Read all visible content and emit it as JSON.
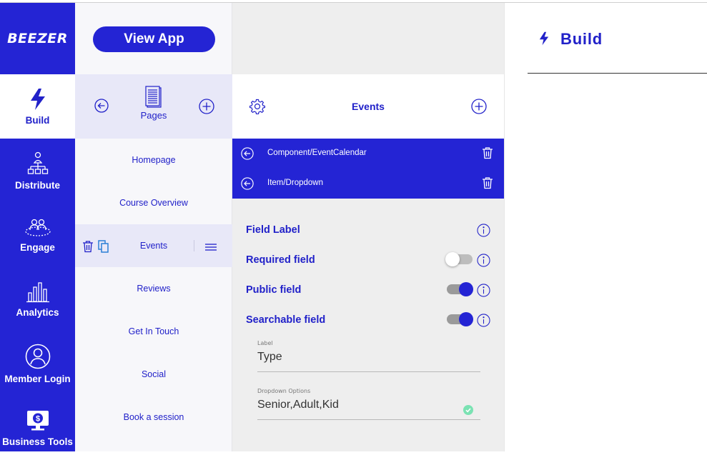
{
  "brand": {
    "logo_text": "BEEZER"
  },
  "nav": {
    "items": [
      {
        "label": "Build",
        "icon": "bolt-icon",
        "active": true
      },
      {
        "label": "Distribute",
        "icon": "org-chart-icon",
        "active": false
      },
      {
        "label": "Engage",
        "icon": "people-icon",
        "active": false
      },
      {
        "label": "Analytics",
        "icon": "bar-chart-icon",
        "active": false
      },
      {
        "label": "Member Login",
        "icon": "user-circle-icon",
        "active": false
      },
      {
        "label": "Business Tools",
        "icon": "dollar-monitor-icon",
        "active": false
      }
    ]
  },
  "pages": {
    "view_app_label": "View App",
    "header_label": "Pages",
    "list": [
      "Homepage",
      "Course Overview",
      "Events",
      "Reviews",
      "Get In Touch",
      "Social",
      "Book a session"
    ],
    "selected": "Events"
  },
  "editor": {
    "title": "Events",
    "breadcrumbs": [
      "Component/EventCalendar",
      "Item/Dropdown"
    ],
    "fields": {
      "field_label": "Field Label",
      "required_label": "Required field",
      "required_on": false,
      "public_label": "Public field",
      "public_on": true,
      "searchable_label": "Searchable field",
      "searchable_on": true
    },
    "label_input": {
      "caption": "Label",
      "value": "Type"
    },
    "options_input": {
      "caption": "Dropdown Options",
      "value": "Senior,Adult,Kid"
    }
  },
  "preview": {
    "title": "Build"
  },
  "colors": {
    "primary": "#2424d4",
    "panel": "#eeeeee",
    "success": "#7be2b3"
  }
}
